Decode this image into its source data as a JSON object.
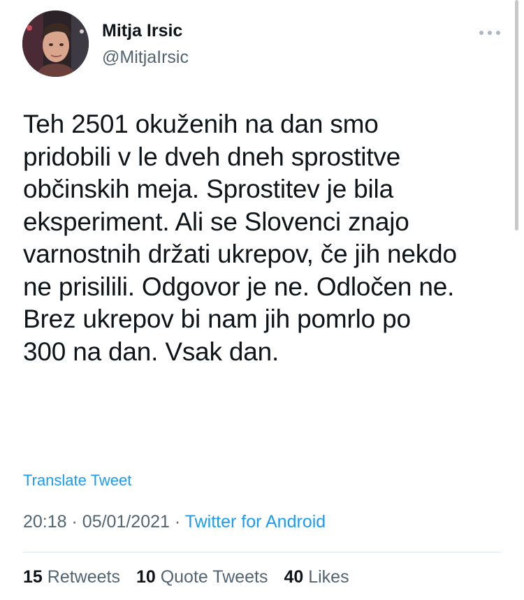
{
  "tweet": {
    "author_name": "Mitja Irsic",
    "author_handle": "@MitjaIrsic",
    "text": "Teh 2501 okuženih na dan smo\npridobili v le dveh dneh sprostitve\nobčinskih meja. Sprostitev je bila\neksperiment. Ali se Slovenci znajo\nvarnostnih držati ukrepov, če jih nekdo\nne prisilili. Odgovor je ne. Odločen ne.\nBrez ukrepov bi nam jih pomrlo po\n300 na dan. Vsak dan.",
    "translate_label": "Translate Tweet",
    "time": "20:18",
    "date": "05/01/2021",
    "separator": "·",
    "source": "Twitter for Android"
  },
  "stats": {
    "retweets_count": "15",
    "retweets_label": "Retweets",
    "quote_count": "10",
    "quote_label": "Quote Tweets",
    "likes_count": "40",
    "likes_label": "Likes"
  },
  "icons": {
    "more": "more-dots-icon"
  },
  "colors": {
    "link": "#1d9bf0",
    "secondary_text": "#536471"
  }
}
